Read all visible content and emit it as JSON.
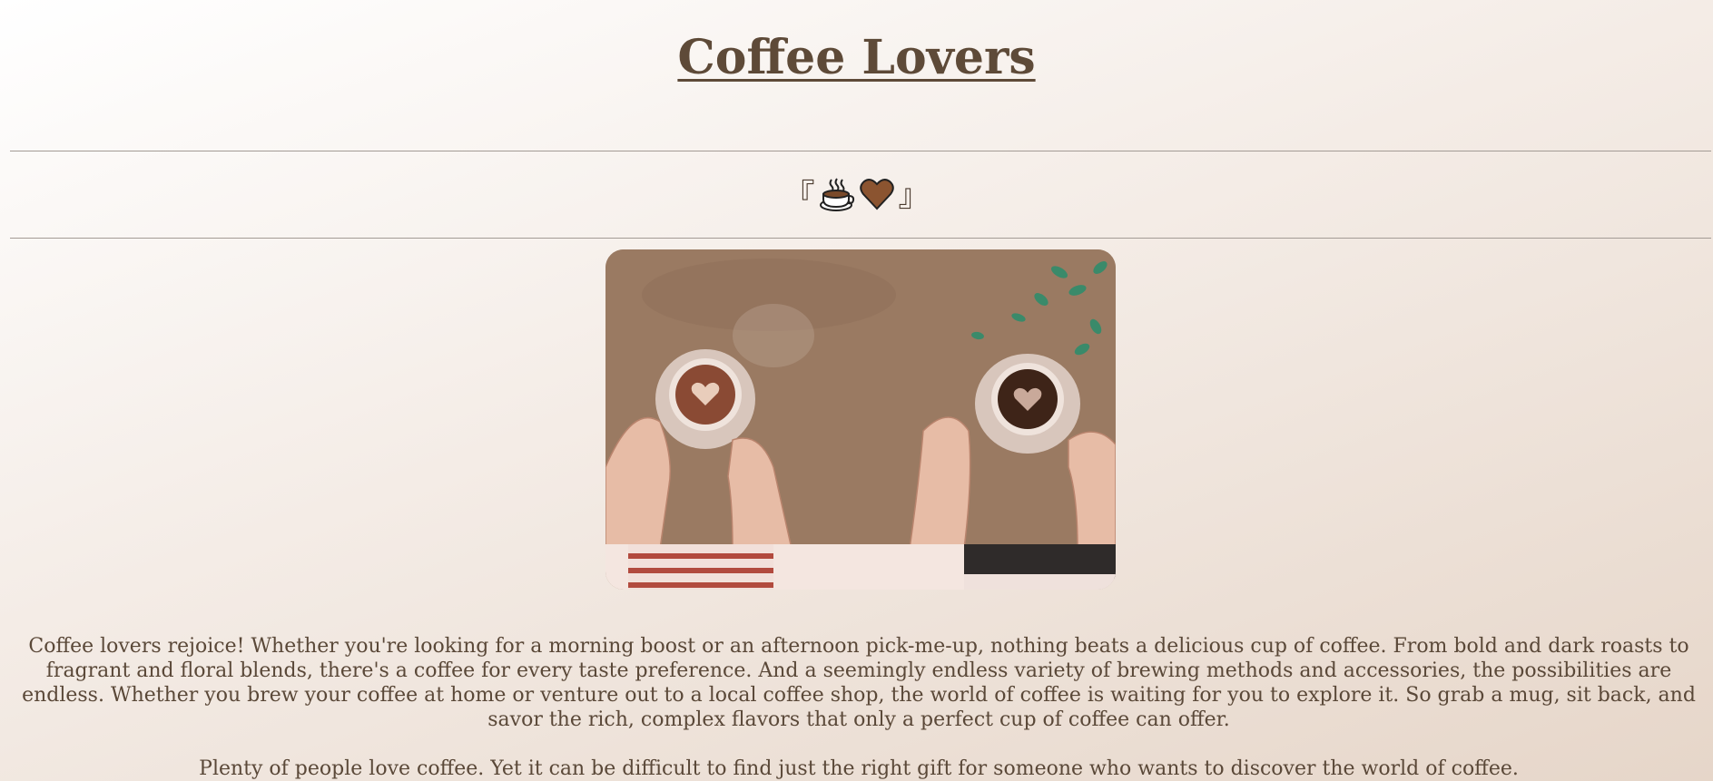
{
  "page": {
    "title": "Coffee Lovers",
    "divider_left": "『",
    "divider_right": "』",
    "divider_icons": [
      "coffee-cup-icon",
      "brown-heart-icon"
    ],
    "colors": {
      "title": "#5e4a38",
      "text": "#5a4838",
      "rule": "#a39b95",
      "table": "#9b7b64"
    }
  },
  "content": {
    "paragraph_1": "Coffee lovers rejoice! Whether you're looking for a morning boost or an afternoon pick-me-up, nothing beats a delicious cup of coffee. From bold and dark roasts to fragrant and floral blends, there's a coffee for every taste preference. And a seemingly endless variety of brewing methods and accessories, the possibilities are endless. Whether you brew your coffee at home or venture out to a local coffee shop, the world of coffee is waiting for you to explore it. So grab a mug, sit back, and savor the rich, complex flavors that only a perfect cup of coffee can offer.",
    "paragraph_2": "Plenty of people love coffee. Yet it can be difficult to find just the right gift for someone who wants to discover the world of coffee."
  }
}
